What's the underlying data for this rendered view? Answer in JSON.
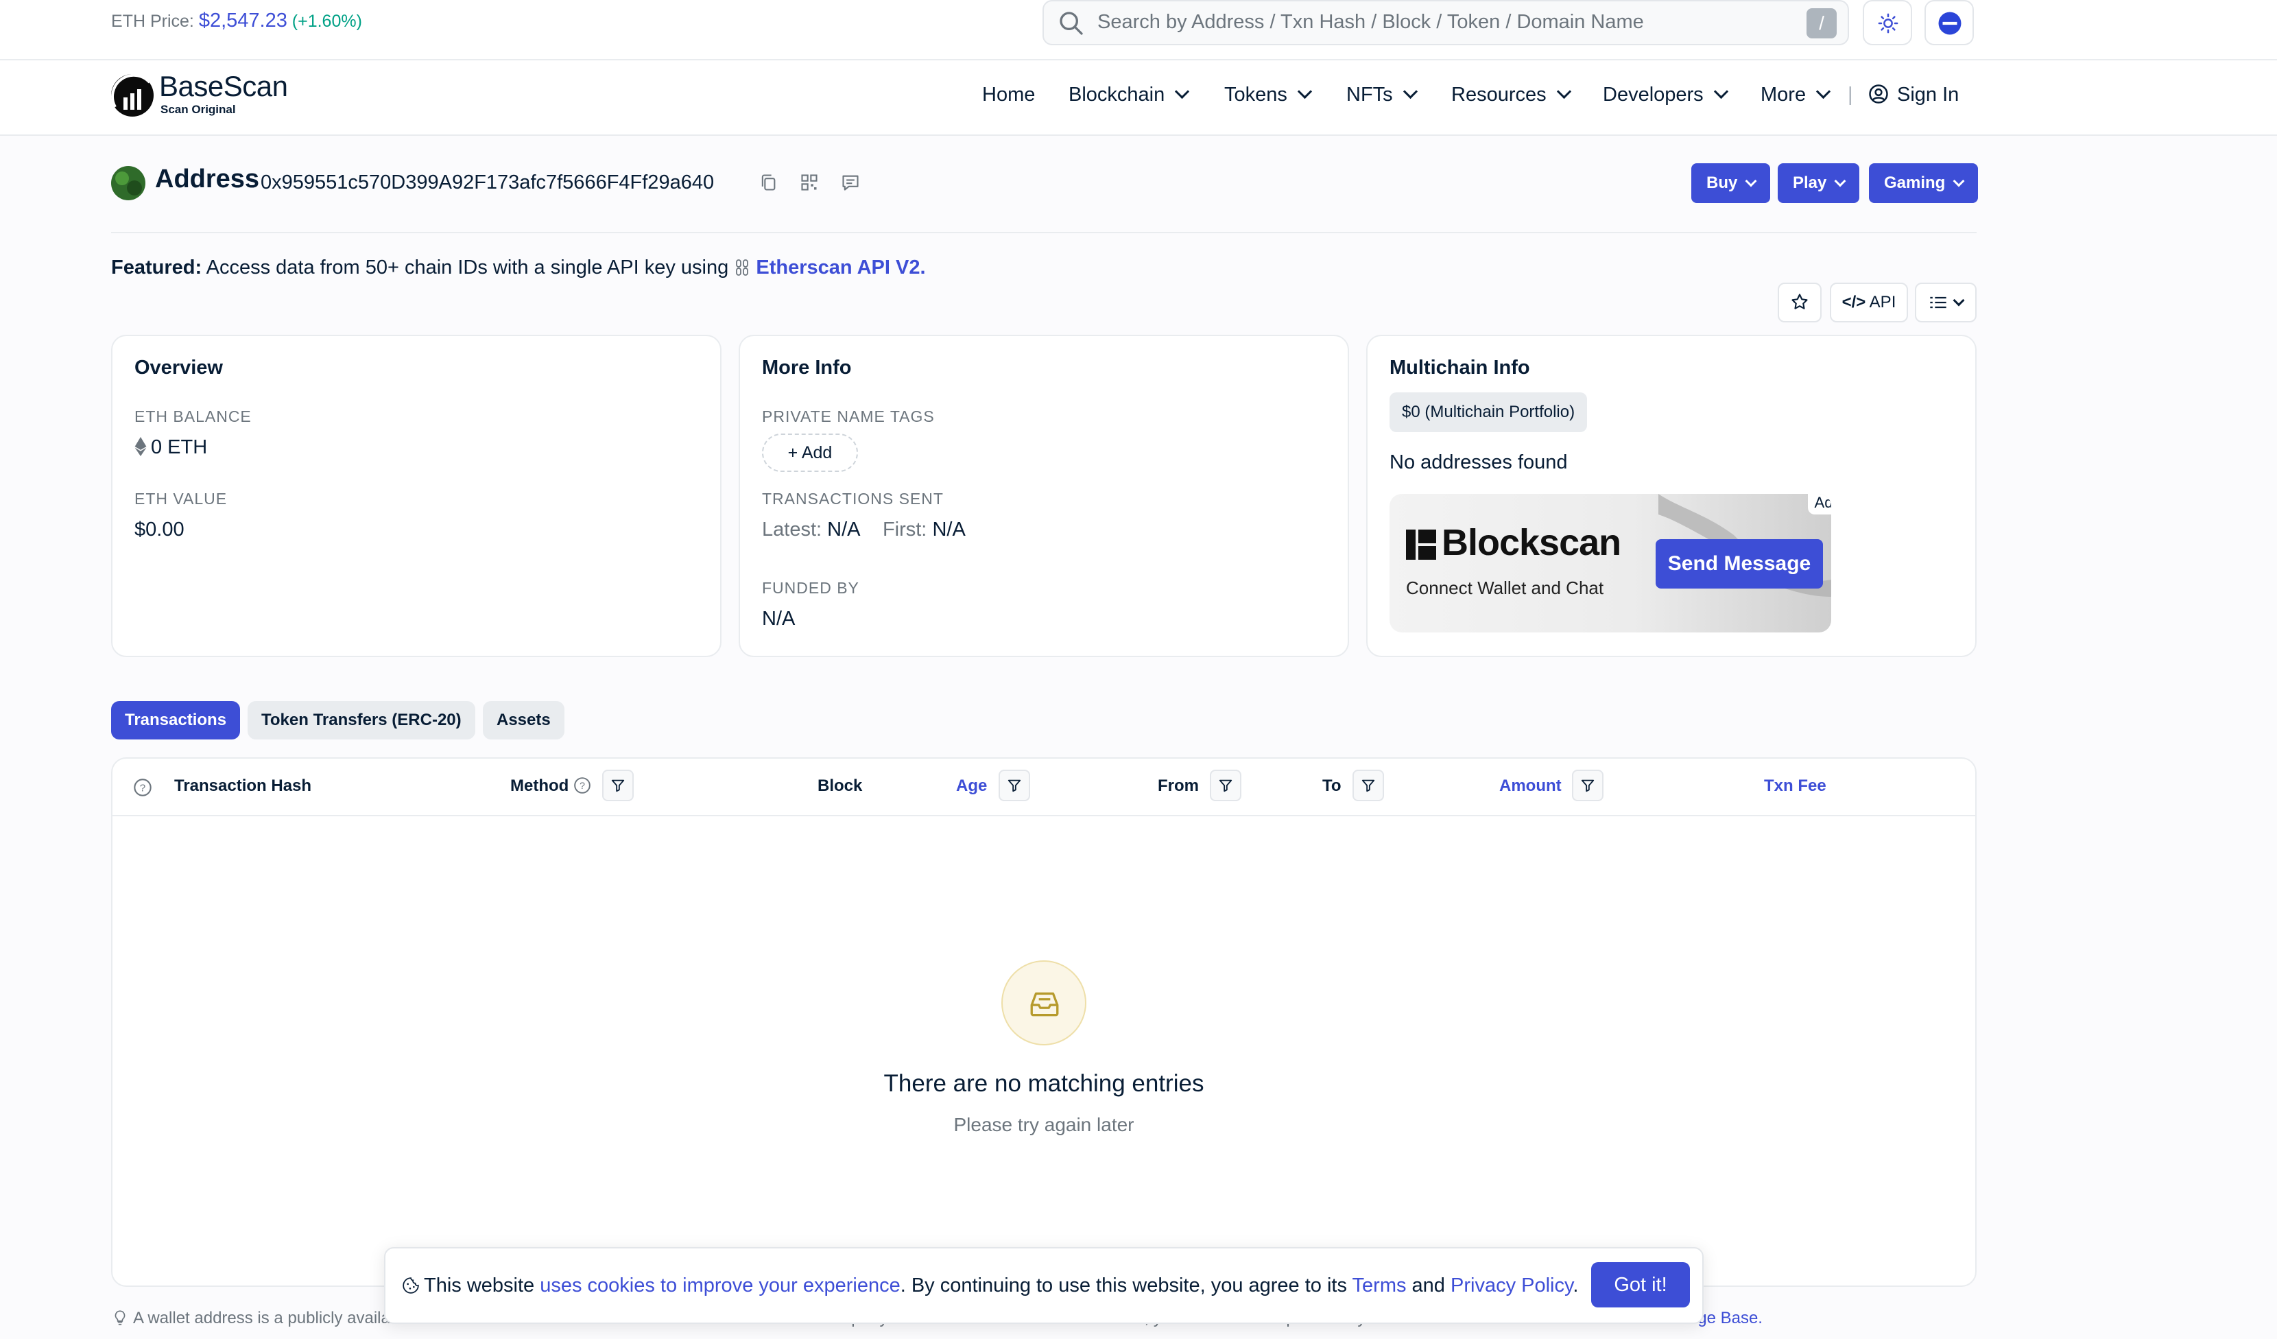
{
  "topbar": {
    "eth_price_label": "ETH Price:",
    "eth_price_value": "$2,547.23",
    "eth_price_change": "(+1.60%)",
    "search_placeholder": "Search by Address / Txn Hash / Block / Token / Domain Name",
    "search_shortcut": "/"
  },
  "header": {
    "logo_name": "BaseScan",
    "logo_sub": "Scan Original",
    "nav": [
      "Home",
      "Blockchain",
      "Tokens",
      "NFTs",
      "Resources",
      "Developers",
      "More"
    ],
    "separator": "|",
    "sign_in": "Sign In"
  },
  "address": {
    "title": "Address",
    "hash": "0x959551c570D399A92F173afc7f5666F4Ff29a640",
    "buttons": [
      "Buy",
      "Play",
      "Gaming"
    ]
  },
  "featured": {
    "label": "Featured:",
    "text": "Access data from 50+ chain IDs with a single API key using",
    "link": "Etherscan API V2."
  },
  "tools": {
    "api_label": "API"
  },
  "overview": {
    "title": "Overview",
    "eth_balance_label": "ETH BALANCE",
    "eth_balance_value": "0 ETH",
    "eth_value_label": "ETH VALUE",
    "eth_value_value": "$0.00"
  },
  "more_info": {
    "title": "More Info",
    "private_tags_label": "PRIVATE NAME TAGS",
    "add_label": "Add",
    "tx_sent_label": "TRANSACTIONS SENT",
    "latest_label": "Latest:",
    "latest_value": "N/A",
    "first_label": "First:",
    "first_value": "N/A",
    "funded_by_label": "FUNDED BY",
    "funded_by_value": "N/A"
  },
  "multichain": {
    "title": "Multichain Info",
    "portfolio": "$0 (Multichain Portfolio)",
    "no_addresses": "No addresses found",
    "ad_brand": "Blockscan",
    "ad_sub": "Connect Wallet and Chat",
    "ad_button": "Send Message",
    "ad_tag": "Ad"
  },
  "tabs": [
    "Transactions",
    "Token Transfers (ERC-20)",
    "Assets"
  ],
  "table": {
    "columns": [
      "Transaction Hash",
      "Method",
      "Block",
      "Age",
      "From",
      "To",
      "Amount",
      "Txn Fee"
    ],
    "empty_title": "There are no matching entries",
    "empty_sub": "Please try again later"
  },
  "footnote": {
    "text": "A wallet address is a publicly available address that allows its owner to receive funds from another party. To access the funds in an address, you must have its private key. Learn more about addresses in our",
    "link": "Knowledge Base."
  },
  "cookie": {
    "text1": "This website",
    "link1": "uses cookies to improve your experience",
    "text2": ". By continuing to use this website, you agree to its",
    "link2": "Terms",
    "text3": "and",
    "link3": "Privacy Policy",
    "text4": ".",
    "button": "Got it!"
  },
  "colors": {
    "accent": "#3d4ed6",
    "text": "#081d35",
    "muted": "#6c757d",
    "positive": "#00a186"
  }
}
